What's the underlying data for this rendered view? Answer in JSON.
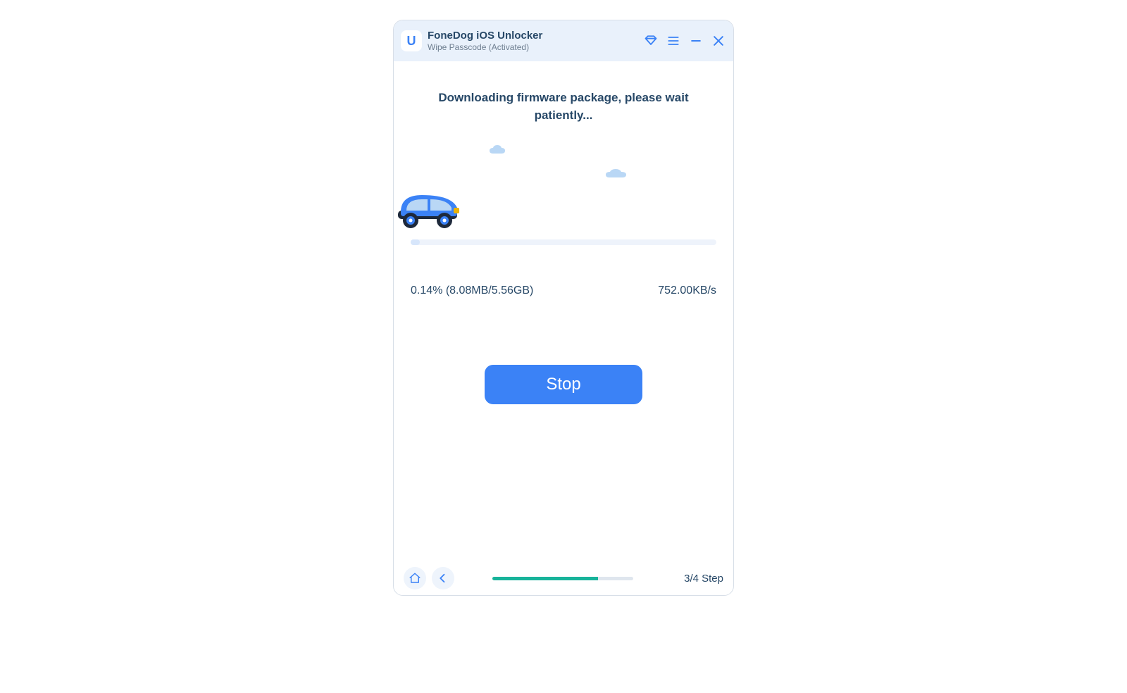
{
  "header": {
    "app_title": "FoneDog iOS Unlocker",
    "subtitle": "Wipe Passcode  (Activated)",
    "logo_glyph": "U"
  },
  "main": {
    "heading": "Downloading firmware package, please wait patiently...",
    "progress_left": "0.14% (8.08MB/5.56GB)",
    "progress_right": "752.00KB/s",
    "stop_label": "Stop"
  },
  "footer": {
    "step_label": "3/4 Step"
  }
}
